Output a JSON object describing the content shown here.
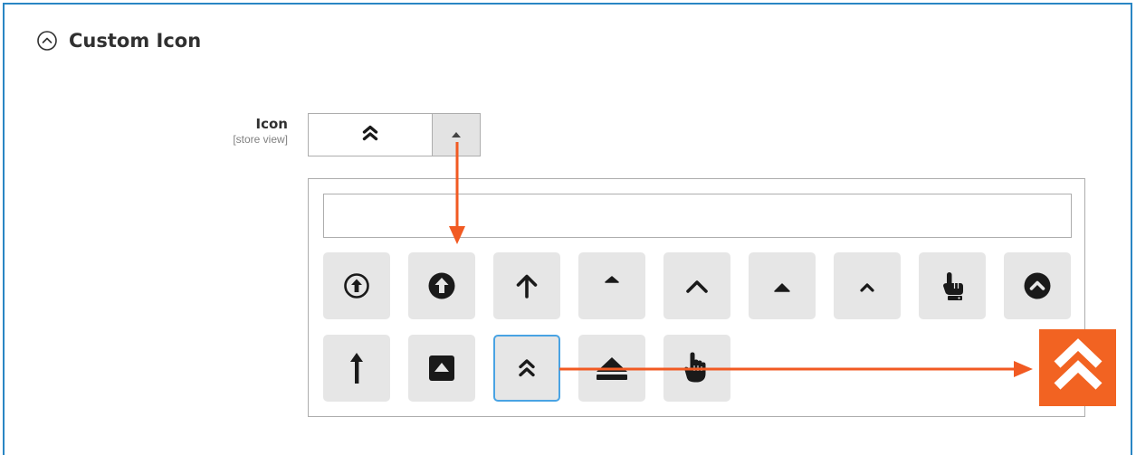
{
  "section": {
    "title": "Custom Icon",
    "collapse_icon": "circle-chevron-up-icon"
  },
  "field": {
    "label": "Icon",
    "scope": "[store view]",
    "selected_icon": "double-chevron-up-icon",
    "toggle_icon": "caret-up-icon"
  },
  "picker": {
    "search_value": "",
    "search_placeholder": "",
    "selected_index": 11,
    "icons": [
      "arrow-up-circle-outline-icon",
      "arrow-up-circle-solid-icon",
      "arrow-up-icon",
      "caret-up-small-icon",
      "chevron-up-icon",
      "caret-up-icon",
      "chevron-up-small-icon",
      "hand-pointer-up-icon",
      "chevron-up-circle-icon",
      "long-arrow-up-icon",
      "caret-square-up-icon",
      "double-chevron-up-icon",
      "eject-icon",
      "hand-pointer-outline-icon"
    ]
  },
  "annotation": {
    "arrow_color": "#f15a22",
    "badge_icon": "double-chevron-up-icon",
    "badge_color": "#f26322"
  },
  "colors": {
    "frame_border": "#2a86c4",
    "selected_border": "#49a3e3",
    "tile_bg": "#e6e6e6"
  }
}
